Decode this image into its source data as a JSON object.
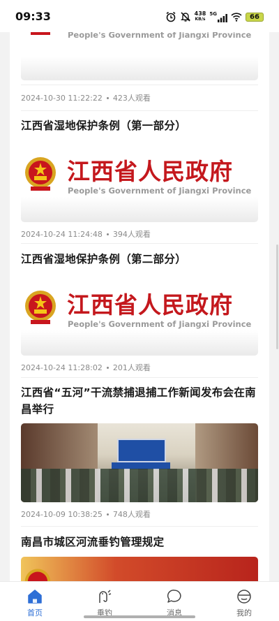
{
  "status_bar": {
    "time": "09:33",
    "net_speed_value": "438",
    "net_speed_unit": "KB/s",
    "network": "5G",
    "battery": "66"
  },
  "banner": {
    "cn": "江西省人民政府",
    "en": "People's Government of Jiangxi Province"
  },
  "feed": {
    "items": [
      {
        "title": "",
        "datetime": "2024-10-30 11:22:22",
        "views": "423人观看",
        "thumb": "banner-cut"
      },
      {
        "title": "江西省湿地保护条例（第一部分）",
        "datetime": "2024-10-24 11:24:48",
        "views": "394人观看",
        "thumb": "banner"
      },
      {
        "title": "江西省湿地保护条例（第二部分）",
        "datetime": "2024-10-24 11:28:02",
        "views": "201人观看",
        "thumb": "banner"
      },
      {
        "title": "江西省“五河”干流禁捕退捕工作新闻发布会在南昌举行",
        "datetime": "2024-10-09 10:38:25",
        "views": "748人观看",
        "thumb": "photo"
      },
      {
        "title": "南昌市城区河流垂钓管理规定",
        "thumb": "orange"
      }
    ]
  },
  "bottom_nav": {
    "items": [
      {
        "label": "首页",
        "icon": "home-icon",
        "active": true
      },
      {
        "label": "垂钓",
        "icon": "fishing-icon",
        "active": false
      },
      {
        "label": "消息",
        "icon": "message-icon",
        "active": false
      },
      {
        "label": "我的",
        "icon": "profile-icon",
        "active": false
      }
    ]
  },
  "colors": {
    "accent": "#2e6fd6",
    "banner_red": "#c4181d"
  }
}
